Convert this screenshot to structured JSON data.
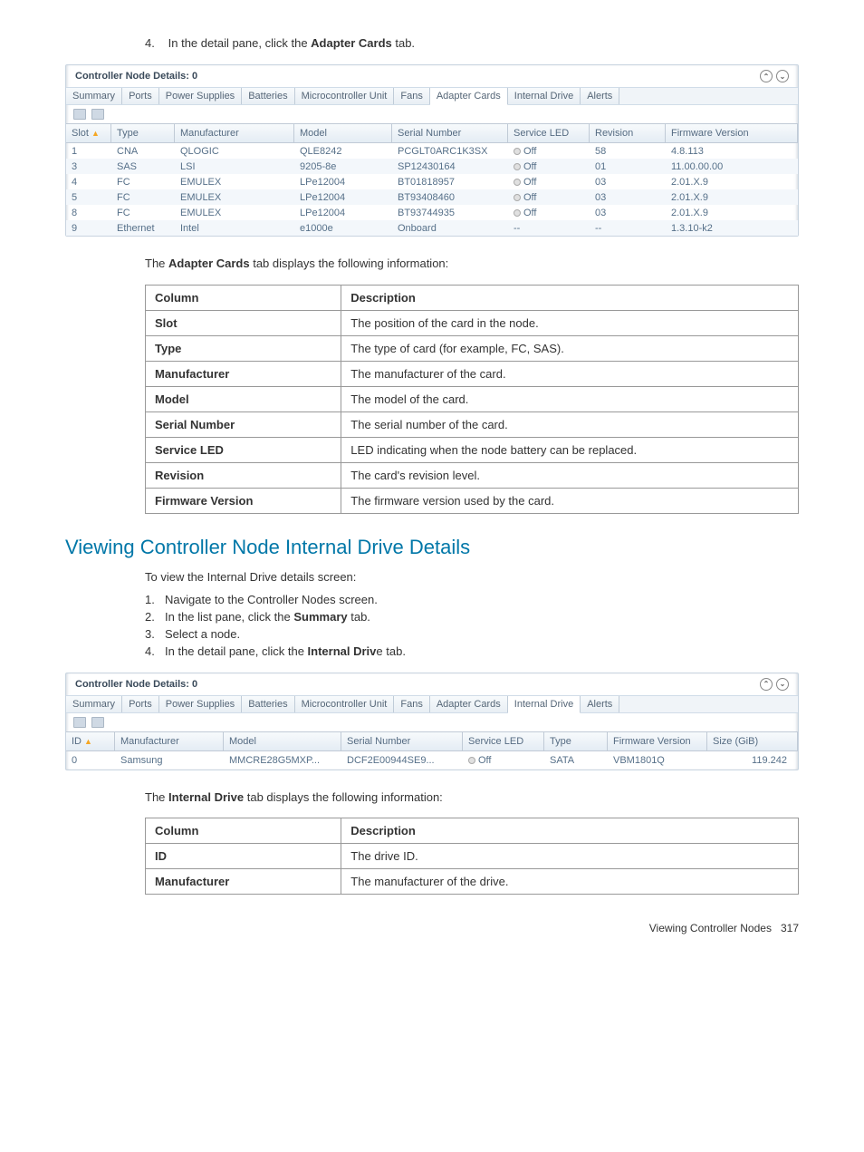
{
  "step4": {
    "num": "4.",
    "pre": "In the detail pane, click the ",
    "bold": "Adapter Cards",
    "post": " tab."
  },
  "panel1": {
    "title": "Controller Node Details: 0",
    "tabs": [
      "Summary",
      "Ports",
      "Power Supplies",
      "Batteries",
      "Microcontroller Unit",
      "Fans",
      "Adapter Cards",
      "Internal Drive",
      "Alerts"
    ],
    "active_index": 6,
    "headers": [
      "Slot",
      "Type",
      "Manufacturer",
      "Model",
      "Serial Number",
      "Service LED",
      "Revision",
      "Firmware Version"
    ],
    "sort_col": 0,
    "rows": [
      {
        "slot": "1",
        "type": "CNA",
        "mfr": "QLOGIC",
        "model": "QLE8242",
        "sn": "PCGLT0ARC1K3SX",
        "led": "Off",
        "rev": "58",
        "fw": "4.8.113"
      },
      {
        "slot": "3",
        "type": "SAS",
        "mfr": "LSI",
        "model": "9205-8e",
        "sn": "SP12430164",
        "led": "Off",
        "rev": "01",
        "fw": "11.00.00.00"
      },
      {
        "slot": "4",
        "type": "FC",
        "mfr": "EMULEX",
        "model": "LPe12004",
        "sn": "BT01818957",
        "led": "Off",
        "rev": "03",
        "fw": "2.01.X.9"
      },
      {
        "slot": "5",
        "type": "FC",
        "mfr": "EMULEX",
        "model": "LPe12004",
        "sn": "BT93408460",
        "led": "Off",
        "rev": "03",
        "fw": "2.01.X.9"
      },
      {
        "slot": "8",
        "type": "FC",
        "mfr": "EMULEX",
        "model": "LPe12004",
        "sn": "BT93744935",
        "led": "Off",
        "rev": "03",
        "fw": "2.01.X.9"
      },
      {
        "slot": "9",
        "type": "Ethernet",
        "mfr": "Intel",
        "model": "e1000e",
        "sn": "Onboard",
        "led": "--",
        "rev": "--",
        "fw": "1.3.10-k2"
      }
    ]
  },
  "desc1_intro": {
    "pre": "The ",
    "bold": "Adapter Cards",
    "post": "  tab displays the following information:"
  },
  "desc1": {
    "h1": "Column",
    "h2": "Description",
    "rows": [
      {
        "c": "Slot",
        "d": "The position of the card in the node."
      },
      {
        "c": "Type",
        "d": "The type of card (for example, FC, SAS)."
      },
      {
        "c": "Manufacturer",
        "d": "The manufacturer of the card."
      },
      {
        "c": "Model",
        "d": "The model of the card."
      },
      {
        "c": "Serial Number",
        "d": "The serial number of the card."
      },
      {
        "c": "Service LED",
        "d": "LED indicating when the node battery can be replaced."
      },
      {
        "c": "Revision",
        "d": "The card's revision level."
      },
      {
        "c": "Firmware Version",
        "d": "The firmware version used by the card."
      }
    ]
  },
  "section2_title": "Viewing Controller Node Internal Drive Details",
  "intro2": "To view the Internal Drive details screen:",
  "steps2": [
    {
      "num": "1.",
      "text": "Navigate to the Controller Nodes screen."
    },
    {
      "num": "2.",
      "pre": "In the list pane, click the ",
      "bold": "Summary",
      "post": " tab."
    },
    {
      "num": "3.",
      "text": "Select a node."
    },
    {
      "num": "4.",
      "pre": "In the detail pane, click the ",
      "bold": "Internal Driv",
      "post": "e tab."
    }
  ],
  "panel2": {
    "title": "Controller Node Details: 0",
    "tabs": [
      "Summary",
      "Ports",
      "Power Supplies",
      "Batteries",
      "Microcontroller Unit",
      "Fans",
      "Adapter Cards",
      "Internal Drive",
      "Alerts"
    ],
    "active_index": 7,
    "headers": [
      "ID",
      "Manufacturer",
      "Model",
      "Serial Number",
      "Service LED",
      "Type",
      "Firmware Version",
      "Size (GiB)"
    ],
    "sort_col": 0,
    "rows": [
      {
        "id": "0",
        "mfr": "Samsung",
        "model": "MMCRE28G5MXP...",
        "sn": "DCF2E00944SE9...",
        "led": "Off",
        "type": "SATA",
        "fw": "VBM1801Q",
        "size": "119.242"
      }
    ]
  },
  "desc2_intro": {
    "pre": "The ",
    "bold": "Internal Drive",
    "post": "  tab displays the following information:"
  },
  "desc2": {
    "h1": "Column",
    "h2": "Description",
    "rows": [
      {
        "c": "ID",
        "d": "The drive ID."
      },
      {
        "c": "Manufacturer",
        "d": "The manufacturer of the drive."
      }
    ]
  },
  "footer": {
    "label": "Viewing Controller Nodes",
    "page": "317"
  }
}
